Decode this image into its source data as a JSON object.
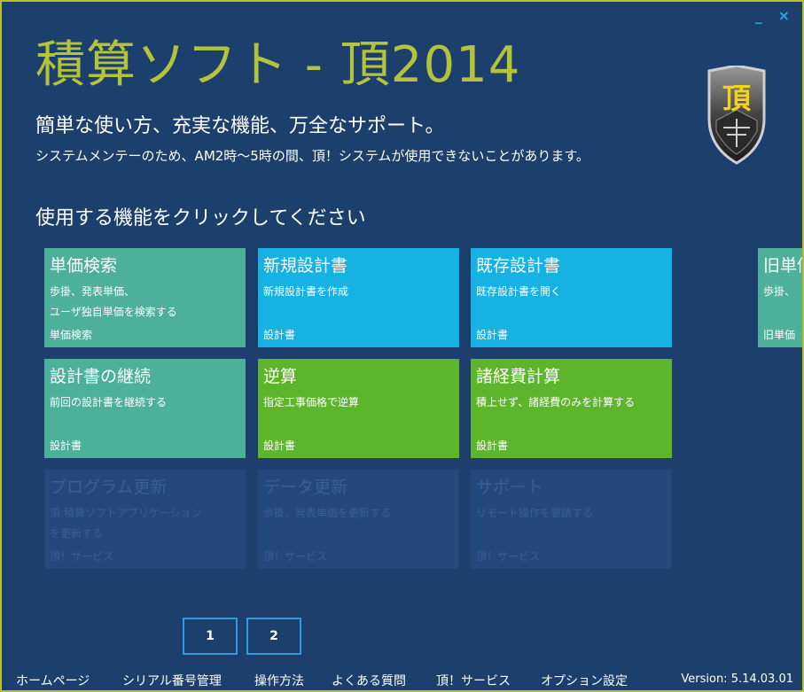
{
  "app": {
    "title": "積算ソフト - 頂2014",
    "tagline": "簡単な使い方、充実な機能、万全なサポート。",
    "notice": "システムメンテーのため、AM2時～5時の間、頂！システムが使用できないことがあります。",
    "prompt": "使用する機能をクリックしてください",
    "emblem_char": "頂"
  },
  "window_controls": {
    "minimize": "_",
    "close": "×"
  },
  "tiles": [
    {
      "title": "単価検索",
      "desc": "歩掛、発表単価、\nユーザ独自単価を検索する",
      "cat": "単価検索",
      "color": "teal"
    },
    {
      "title": "新規設計書",
      "desc": "新規設計書を作成",
      "cat": "設計書",
      "color": "cyan"
    },
    {
      "title": "既存設計書",
      "desc": "既存設計書を開く",
      "cat": "設計書",
      "color": "cyan"
    },
    {
      "title": "旧単価",
      "desc": "歩掛、",
      "cat": "旧単価",
      "color": "teal"
    },
    {
      "title": "設計書の継続",
      "desc": "前回の設計書を継続する",
      "cat": "設計書",
      "color": "teal"
    },
    {
      "title": "逆算",
      "desc": "指定工事価格で逆算",
      "cat": "設計書",
      "color": "green"
    },
    {
      "title": "諸経費計算",
      "desc": "積上せず、諸経費のみを計算する",
      "cat": "設計書",
      "color": "green"
    },
    {
      "title": "プログラム更新",
      "desc": "頂:積算ソフトアプリケーション\nを更新する",
      "cat": "頂！サービス",
      "color": "disabled"
    },
    {
      "title": "データ更新",
      "desc": "歩掛、発表単価を更新する",
      "cat": "頂！サービス",
      "color": "disabled"
    },
    {
      "title": "サポート",
      "desc": "リモート操作を要請する",
      "cat": "頂！サービス",
      "color": "disabled"
    }
  ],
  "pagination": [
    "1",
    "2"
  ],
  "footer": {
    "links": [
      "ホームページ",
      "シリアル番号管理",
      "操作方法",
      "よくある質問",
      "頂！サービス",
      "オプション設定"
    ],
    "version": "Version: 5.14.03.01"
  },
  "colors": {
    "background": "#1c3f6d",
    "title": "#b3c43b",
    "frame": "#b7c22a",
    "teal": "#4db09a",
    "cyan": "#15b2e3",
    "green": "#5db52c",
    "disabled": "#23497c"
  }
}
